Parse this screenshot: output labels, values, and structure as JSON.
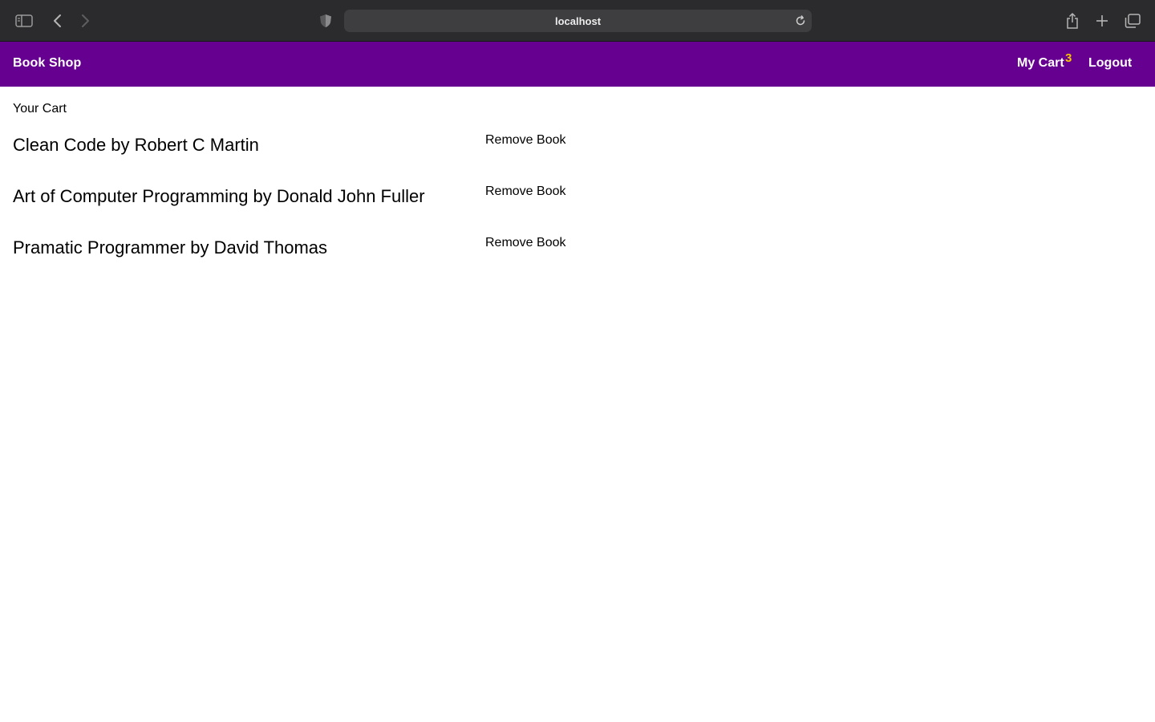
{
  "browser": {
    "url": "localhost",
    "icons": {
      "sidebar": "sidebar-icon",
      "back": "chevron-left-icon",
      "forward": "chevron-right-icon",
      "privacy": "shield-icon",
      "reload": "reload-icon",
      "share": "share-icon",
      "new_tab": "plus-icon",
      "tabs": "tabs-overview-icon"
    }
  },
  "navbar": {
    "brand": "Book Shop",
    "cart_label": "My Cart",
    "cart_count": "3",
    "logout_label": "Logout",
    "colors": {
      "background": "#660090",
      "text": "#ffffff",
      "badge": "#f5c400"
    }
  },
  "cart": {
    "heading": "Your Cart",
    "items": [
      {
        "title": "Clean Code by Robert C Martin",
        "action": "Remove Book"
      },
      {
        "title": "Art of Computer Programming by Donald John Fuller",
        "action": "Remove Book"
      },
      {
        "title": "Pramatic Programmer by David Thomas",
        "action": "Remove Book"
      }
    ]
  }
}
